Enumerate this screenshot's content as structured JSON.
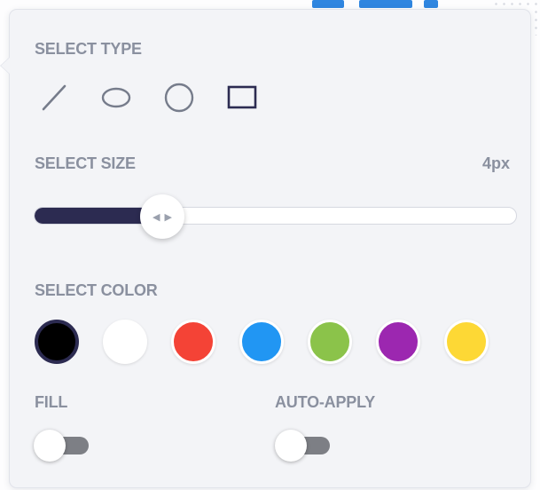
{
  "popover": {
    "select_type_label": "SELECT TYPE",
    "select_size_label": "SELECT SIZE",
    "size_value": "4px",
    "size_slider_fraction": 0.27,
    "select_color_label": "SELECT COLOR",
    "fill_label": "FILL",
    "auto_apply_label": "AUTO-APPLY"
  },
  "shape_types": [
    {
      "name": "line",
      "icon": "line-icon"
    },
    {
      "name": "ellipse",
      "icon": "ellipse-icon"
    },
    {
      "name": "circle",
      "icon": "circle-icon"
    },
    {
      "name": "rectangle",
      "icon": "rectangle-icon",
      "selected": true
    }
  ],
  "colors": [
    {
      "name": "black",
      "hex": "#000000",
      "selected": true
    },
    {
      "name": "white",
      "hex": "#ffffff"
    },
    {
      "name": "red",
      "hex": "#f44336"
    },
    {
      "name": "blue",
      "hex": "#2196f3"
    },
    {
      "name": "green",
      "hex": "#8bc34a"
    },
    {
      "name": "purple",
      "hex": "#9c27b0"
    },
    {
      "name": "yellow",
      "hex": "#fdd835"
    }
  ],
  "toggles": {
    "fill": false,
    "auto_apply": false
  },
  "theme": {
    "accent": "#2c2b51",
    "label_color": "#8a909f",
    "toggle_off_color": "#7d7f85"
  }
}
